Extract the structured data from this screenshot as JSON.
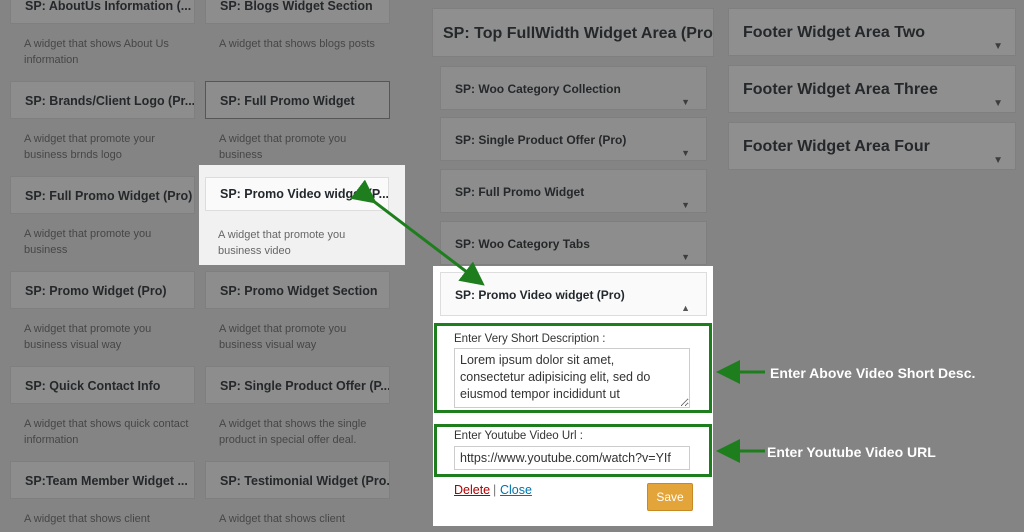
{
  "available_widgets": [
    {
      "title": "SP: AboutUs Information (...",
      "desc": "A widget that shows About Us information"
    },
    {
      "title": "SP: Blogs Widget Section",
      "desc": "A widget that shows blogs posts"
    },
    {
      "title": "SP: Brands/Client Logo (Pr...",
      "desc": "A widget that promote your business brnds logo"
    },
    {
      "title": "SP: Full Promo Widget",
      "desc": "A widget that promote you business"
    },
    {
      "title": "SP: Full Promo Widget (Pro)",
      "desc": "A widget that promote you business"
    },
    {
      "title": "SP: Promo Video widget (P...",
      "desc": "A widget that promote you business video"
    },
    {
      "title": "SP: Promo Widget (Pro)",
      "desc": "A widget that promote you business visual way"
    },
    {
      "title": "SP: Promo Widget Section",
      "desc": "A widget that promote you business visual way"
    },
    {
      "title": "SP: Quick Contact Info",
      "desc": "A widget that shows quick contact information"
    },
    {
      "title": "SP: Single Product Offer (P...",
      "desc": "A widget that shows the single product in special offer deal."
    },
    {
      "title": "SP:Team Member Widget ...",
      "desc": "A widget that shows client"
    },
    {
      "title": "SP: Testimonial Widget (Pro...",
      "desc": "A widget that shows client"
    }
  ],
  "top_area": {
    "title": "SP: Top FullWidth Widget Area (Pro)",
    "widgets": [
      "SP: Woo Category Collection",
      "SP: Single Product Offer (Pro)",
      "SP: Full Promo Widget",
      "SP: Woo Category Tabs"
    ]
  },
  "open_widget": {
    "title": "SP: Promo Video widget (Pro)",
    "desc_label": "Enter Very Short Description :",
    "desc_value": "Lorem ipsum dolor sit amet, consectetur adipisicing elit, sed do eiusmod tempor incididunt ut",
    "url_label": "Enter Youtube Video Url :",
    "url_value": "https://www.youtube.com/watch?v=YIf",
    "delete_label": "Delete",
    "separator": "|",
    "close_label": "Close",
    "save_label": "Save"
  },
  "footer_areas": [
    "Footer Widget Area Two",
    "Footer Widget Area Three",
    "Footer Widget Area Four"
  ],
  "annotations": {
    "desc_note": "Enter Above Video Short Desc.",
    "url_note": "Enter Youtube Video URL"
  },
  "icons": {
    "collapse": "triangle-down-icon",
    "expand": "triangle-up-icon"
  },
  "colors": {
    "annotation_green": "#1e7e1e",
    "save_button": "#e3a43a",
    "delete_link": "#a00",
    "close_link": "#0073aa"
  }
}
